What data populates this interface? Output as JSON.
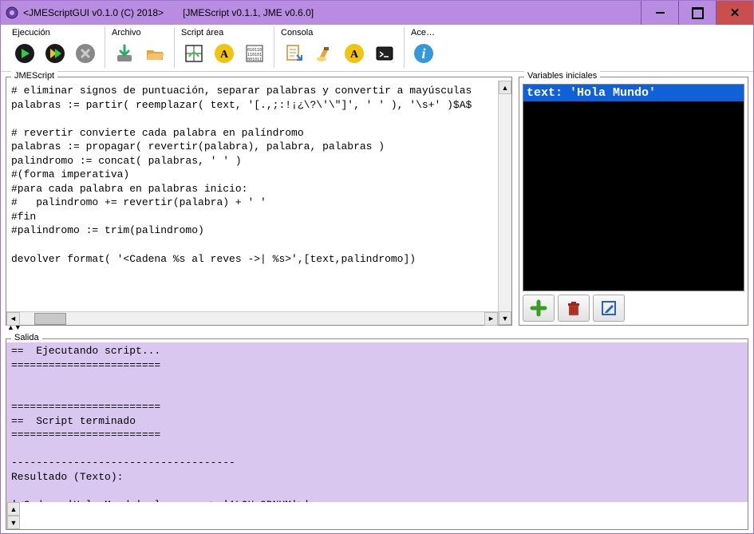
{
  "window": {
    "title1": "<JMEScriptGUI v0.1.0  (C) 2018>",
    "title2": "[JMEScript v0.1.1, JME v0.6.0]"
  },
  "toolbar": {
    "groups": {
      "ejecucion": "Ejecución",
      "archivo": "Archivo",
      "script": "Script área",
      "consola": "Consola",
      "ace": "Ace…"
    }
  },
  "panels": {
    "script": "JMEScript",
    "vars": "Variables iniciales",
    "salida": "Salida"
  },
  "script_text": "# eliminar signos de puntuación, separar palabras y convertir a mayúsculas\npalabras := partir( reemplazar( text, '[.,;:!¡¿\\?\\'\\\"]', ' ' ), '\\s+' )$A$\n\n# revertir convierte cada palabra en palíndromo\npalabras := propagar( revertir(palabra), palabra, palabras )\npalindromo := concat( palabras, ' ' )\n#(forma imperativa)\n#para cada palabra en palabras inicio:\n#   palindromo += revertir(palabra) + ' '\n#fin\n#palindromo := trim(palindromo)\n\ndevolver format( '<Cadena %s al reves ->| %s>',[text,palindromo])",
  "vars": {
    "rows": [
      "text:  'Hola Mundo'"
    ]
  },
  "output_text": "==  Ejecutando script...\n========================\n\n\n========================\n==  Script terminado\n========================\n\n------------------------------------\nResultado (Texto):\n\n'<Cadena 'Hola Mundo' al reves -> 'ALOH ODNUM'>'\n------------------------------------"
}
